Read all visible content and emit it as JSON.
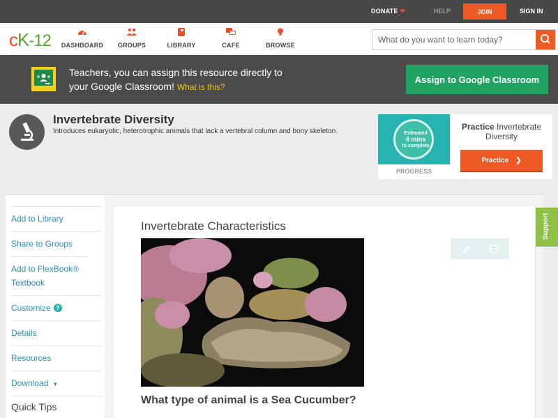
{
  "topbar": {
    "donate_label": "DONATE",
    "help_label": "HELP",
    "join_label": "JOIN",
    "signin_label": "SIGN IN"
  },
  "header": {
    "logo_c": "c",
    "logo_k": "K",
    "logo_num": "-12",
    "nav": [
      {
        "label": "DASHBOARD",
        "icon": "dashboard-gauge-icon"
      },
      {
        "label": "GROUPS",
        "icon": "groups-people-icon"
      },
      {
        "label": "LIBRARY",
        "icon": "library-book-icon"
      },
      {
        "label": "CAFE",
        "icon": "cafe-chat-icon"
      },
      {
        "label": "BROWSE",
        "icon": "browse-bulb-icon"
      }
    ],
    "search_placeholder": "What do you want to learn today?"
  },
  "banner": {
    "line1": "Teachers, you can assign this resource directly to",
    "line2": "your Google Classroom!",
    "what_link": "What is this?",
    "assign_button": "Assign to Google Classroom"
  },
  "concept": {
    "title": "Invertebrate Diversity",
    "description": "Introduces eukaryotic, heterotrophic animals that lack a vertebral column and bony skeleton."
  },
  "practice_card": {
    "estimated": "Estimated",
    "minutes": "4 mins",
    "to_complete": "to complete",
    "progress_label": "PROGRESS",
    "title_bold": "Practice",
    "title_rest": "Invertebrate Diversity",
    "button_label": "Practice"
  },
  "sidebar": {
    "items": [
      {
        "label": "Add to Library"
      },
      {
        "label": "Share to Groups"
      },
      {
        "label": "Add to FlexBook® Textbook"
      },
      {
        "label": "Customize"
      },
      {
        "label": "Details"
      },
      {
        "label": "Resources"
      },
      {
        "label": "Download"
      }
    ],
    "quick_tips": "Quick Tips"
  },
  "lesson": {
    "heading": "Invertebrate Characteristics",
    "question": "What type of animal is a Sea Cucumber?",
    "image_subject": "sea-cucumber-photo"
  },
  "support_tab": "Support",
  "colors": {
    "brand_orange": "#ee5a24",
    "classroom_green": "#1fa463",
    "link_blue": "#2b8fb3",
    "teal": "#27b4b0",
    "support_green": "#8dc044"
  }
}
